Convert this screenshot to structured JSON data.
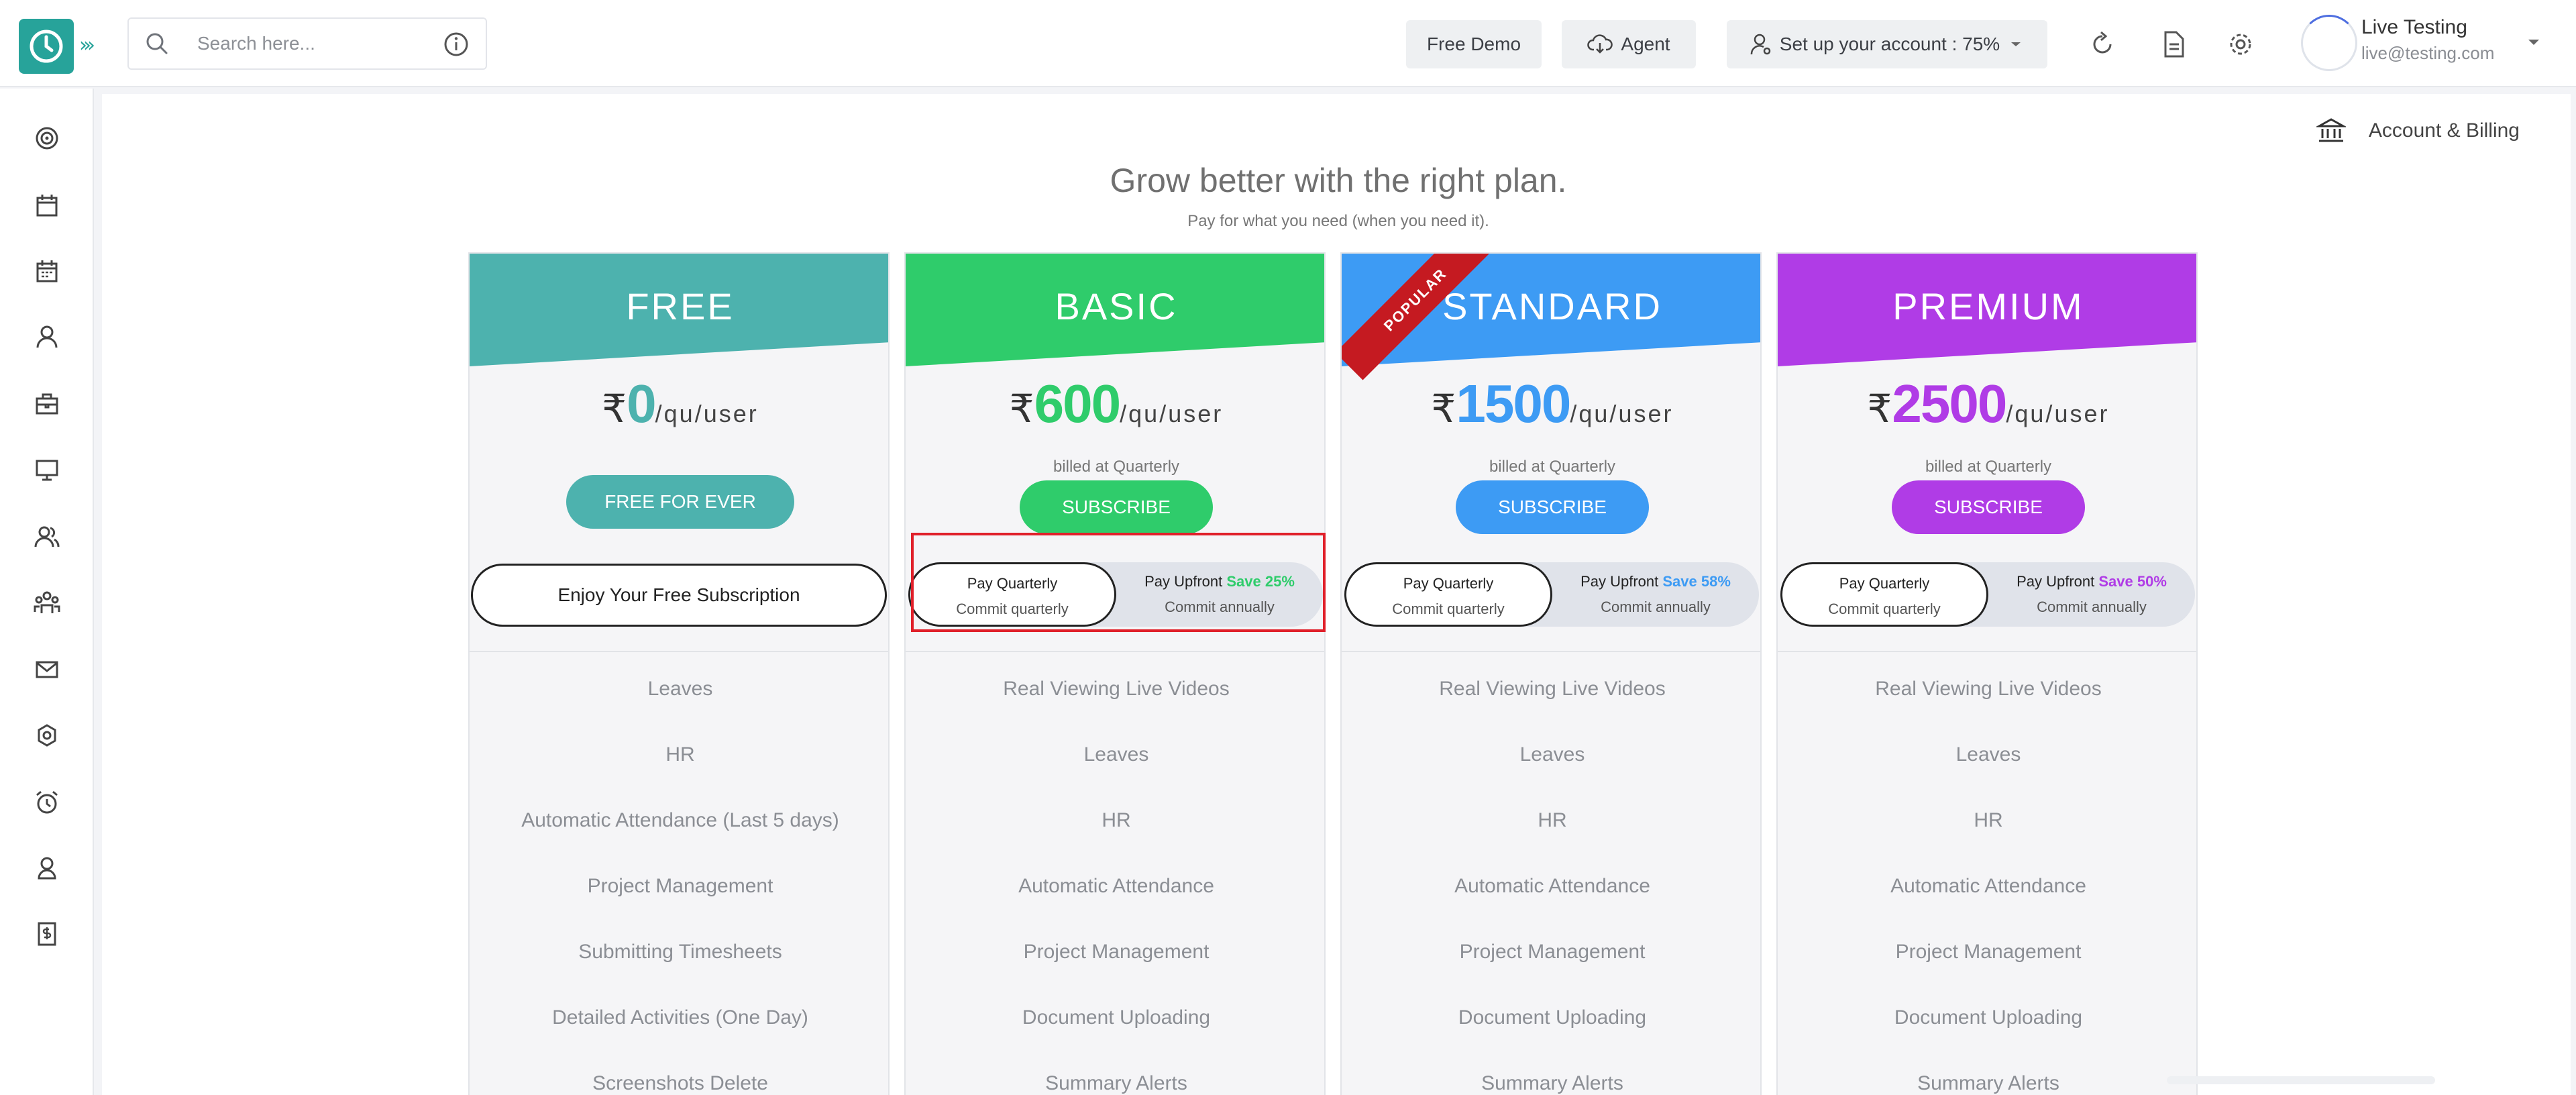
{
  "search": {
    "placeholder": "Search here..."
  },
  "toolbar": {
    "free_demo": "Free Demo",
    "agent": "Agent",
    "setup": "Set up your account : 75%"
  },
  "user": {
    "name": "Live Testing",
    "email": "live@testing.com"
  },
  "sidebar_icons": [
    "dashboard-icon",
    "calendar-icon",
    "schedule-icon",
    "user-icon",
    "briefcase-icon",
    "monitor-icon",
    "users-icon",
    "team-icon",
    "mail-icon",
    "settings-icon",
    "alarm-icon",
    "award-icon",
    "invoice-icon"
  ],
  "account_billing": "Account & Billing",
  "headline": "Grow better with the right plan.",
  "subhead": "Pay for what you need (when you need it).",
  "colors": {
    "free": "#4db2ae",
    "basic": "#2fcc6b",
    "standard": "#3d9bf4",
    "premium": "#b03ce6"
  },
  "plans": {
    "free": {
      "title": "FREE",
      "currency": "₹",
      "price": "0",
      "per": "/qu/user",
      "cta": "FREE FOR EVER",
      "subscription": "Enjoy Your Free Subscription",
      "features": [
        "Leaves",
        "HR",
        "Automatic Attendance (Last 5 days)",
        "Project Management",
        "Submitting Timesheets",
        "Detailed Activities (One Day)",
        "Screenshots Delete"
      ]
    },
    "basic": {
      "title": "BASIC",
      "currency": "₹",
      "price": "600",
      "per": "/qu/user",
      "billed": "billed at Quarterly",
      "cta": "SUBSCRIBE",
      "opt_a1": "Pay Quarterly",
      "opt_a2": "Commit quarterly",
      "opt_b1": "Pay Upfront",
      "opt_b_save": "Save 25%",
      "opt_b2": "Commit annually",
      "features": [
        "Real Viewing Live Videos",
        "Leaves",
        "HR",
        "Automatic Attendance",
        "Project Management",
        "Document Uploading",
        "Summary Alerts"
      ]
    },
    "standard": {
      "title": "STANDARD",
      "ribbon": "POPULAR",
      "currency": "₹",
      "price": "1500",
      "per": "/qu/user",
      "billed": "billed at Quarterly",
      "cta": "SUBSCRIBE",
      "opt_a1": "Pay Quarterly",
      "opt_a2": "Commit quarterly",
      "opt_b1": "Pay Upfront",
      "opt_b_save": "Save 58%",
      "opt_b2": "Commit annually",
      "features": [
        "Real Viewing Live Videos",
        "Leaves",
        "HR",
        "Automatic Attendance",
        "Project Management",
        "Document Uploading",
        "Summary Alerts"
      ]
    },
    "premium": {
      "title": "PREMIUM",
      "currency": "₹",
      "price": "2500",
      "per": "/qu/user",
      "billed": "billed at Quarterly",
      "cta": "SUBSCRIBE",
      "opt_a1": "Pay Quarterly",
      "opt_a2": "Commit quarterly",
      "opt_b1": "Pay Upfront",
      "opt_b_save": "Save 50%",
      "opt_b2": "Commit annually",
      "features": [
        "Real Viewing Live Videos",
        "Leaves",
        "HR",
        "Automatic Attendance",
        "Project Management",
        "Document Uploading",
        "Summary Alerts"
      ]
    }
  }
}
